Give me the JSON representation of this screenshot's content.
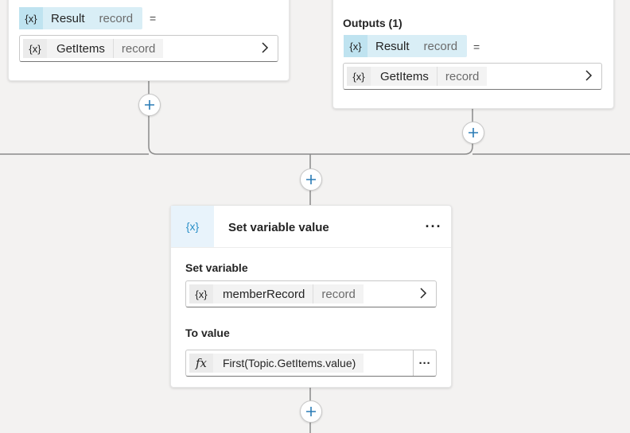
{
  "left_card": {
    "result_tag": {
      "icon": "{x}",
      "name": "Result",
      "type": "record"
    },
    "equals": "=",
    "getitems_field": {
      "icon": "{x}",
      "name": "GetItems",
      "type": "record"
    }
  },
  "right_card": {
    "outputs_label": "Outputs (1)",
    "result_tag": {
      "icon": "{x}",
      "name": "Result",
      "type": "record"
    },
    "equals": "=",
    "getitems_field": {
      "icon": "{x}",
      "name": "GetItems",
      "type": "record"
    }
  },
  "set_variable_node": {
    "icon": "{x}",
    "title": "Set variable value",
    "more": "···",
    "set_variable_label": "Set variable",
    "variable_field": {
      "icon": "{x}",
      "name": "memberRecord",
      "type": "record"
    },
    "to_value_label": "To value",
    "formula_field": {
      "icon": "fx",
      "text": "First(Topic.GetItems.value)",
      "more": "···"
    }
  },
  "colors": {
    "canvas": "#f3f2f1",
    "tag_bg": "#d9eef6",
    "node_icon": "#2a8fc7",
    "connector": "#8a8a8a"
  }
}
